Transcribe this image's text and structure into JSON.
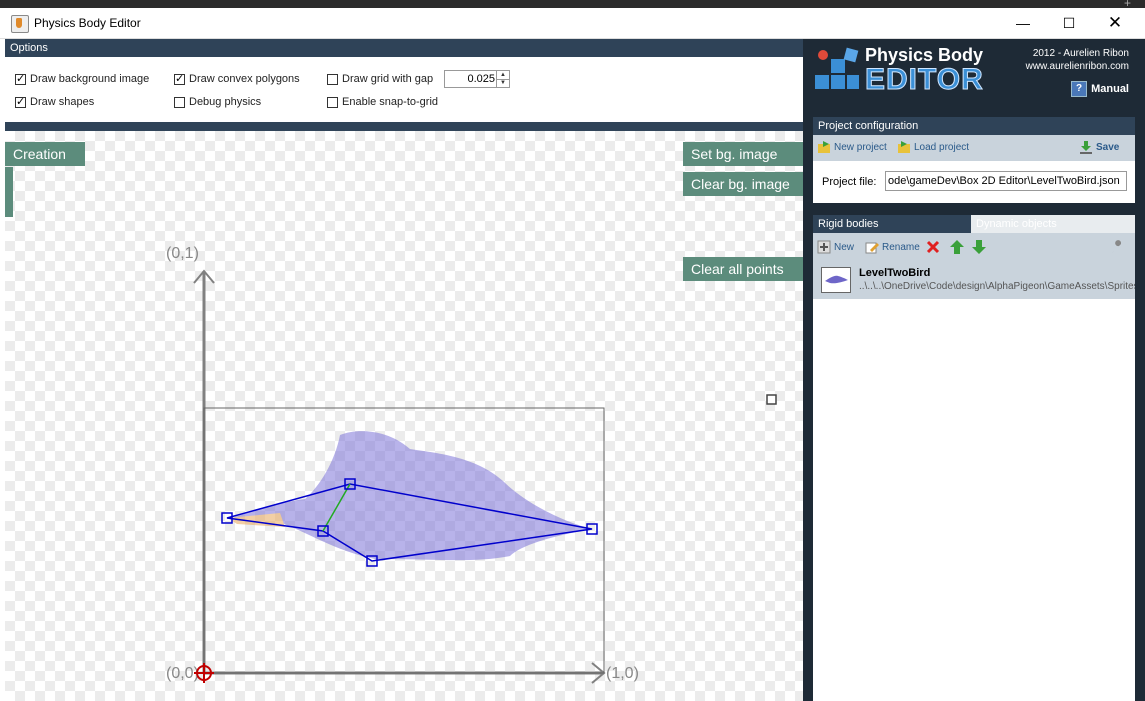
{
  "window": {
    "title": "Physics Body Editor"
  },
  "options": {
    "header": "Options",
    "draw_background_image": {
      "label": "Draw background image",
      "checked": true
    },
    "draw_shapes": {
      "label": "Draw shapes",
      "checked": true
    },
    "draw_convex_polygons": {
      "label": "Draw convex polygons",
      "checked": true
    },
    "debug_physics": {
      "label": "Debug physics",
      "checked": false
    },
    "draw_grid": {
      "label": "Draw grid with gap",
      "checked": false
    },
    "snap_to_grid": {
      "label": "Enable snap-to-grid",
      "checked": false
    },
    "grid_gap": "0.025"
  },
  "canvas": {
    "creation_button": "Creation",
    "set_bg_button": "Set bg. image",
    "clear_bg_button": "Clear bg. image",
    "clear_points_button": "Clear all points",
    "axis_y_label": "(0,1)",
    "origin_label": "(0,0)",
    "axis_x_label": "(1,0)"
  },
  "logo": {
    "title": "Physics Body",
    "editor": "EDITOR",
    "copyright": "2012 - Aurelien Ribon",
    "website": "www.aurelienribon.com",
    "manual": "Manual"
  },
  "project": {
    "header": "Project configuration",
    "new_label": "New project",
    "load_label": "Load project",
    "save_label": "Save",
    "file_label": "Project file:",
    "file_value": "ode\\gameDev\\Box 2D Editor\\LevelTwoBird.json"
  },
  "bodies": {
    "tab_rigid": "Rigid bodies",
    "tab_dynamic": "Dynamic objects",
    "new_label": "New",
    "rename_label": "Rename",
    "items": [
      {
        "name": "LevelTwoBird",
        "path": "..\\..\\..\\OneDrive\\Code\\design\\AlphaPigeon\\GameAssets\\Sprites"
      }
    ]
  },
  "colors": {
    "accent_green": "#5c8c7c",
    "header_blue": "#2f4358",
    "polygon": "#0000cc"
  }
}
